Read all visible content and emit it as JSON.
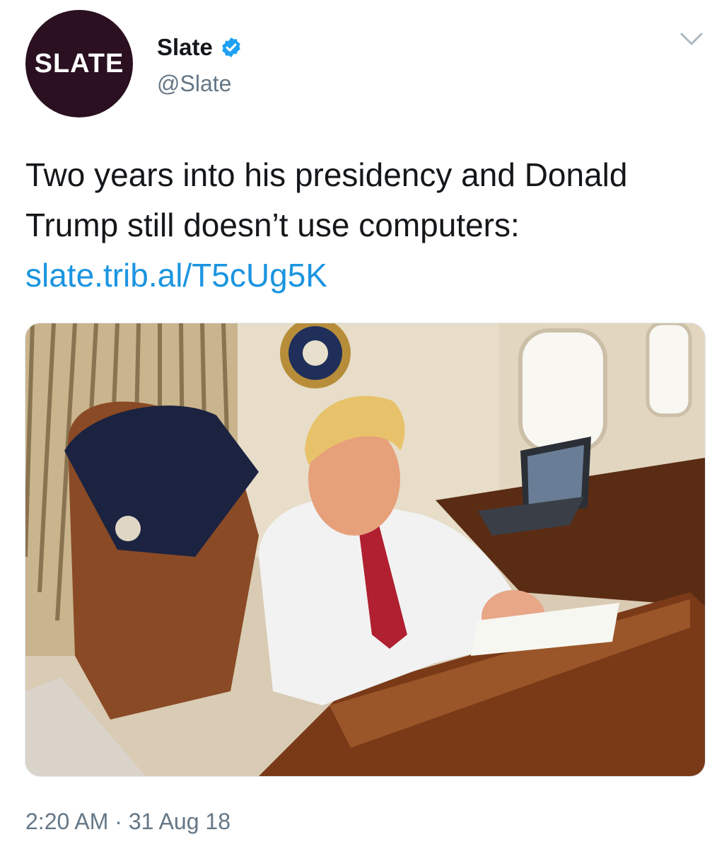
{
  "author": {
    "avatar_text": "SLATE",
    "display_name": "Slate",
    "handle": "@Slate",
    "verified": true
  },
  "tweet": {
    "text": "Two years into his presidency and Donald Trump still doesn’t use computers: ",
    "link": "slate.trib.al/T5cUg5K",
    "timestamp": "2:20 AM · 31 Aug 18"
  },
  "media": {
    "kind": "photo"
  },
  "colors": {
    "link": "#1b95e0",
    "verified_badge": "#1da1f2",
    "avatar_bg": "#2a1020",
    "secondary_text": "#657786"
  },
  "icons": {
    "verified": "verified-badge-icon",
    "menu": "chevron-down-icon"
  }
}
